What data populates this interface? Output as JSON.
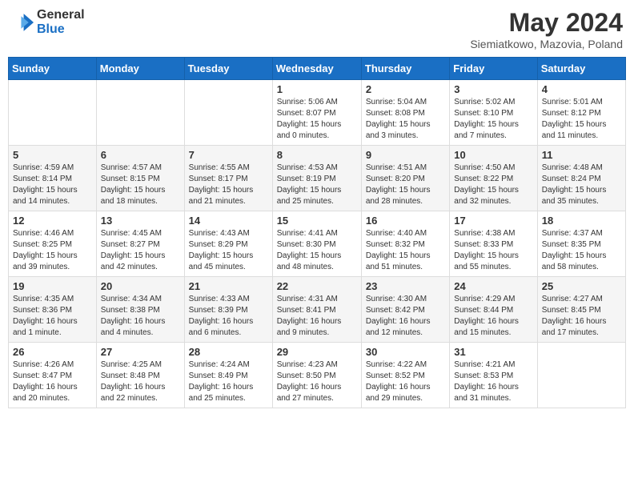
{
  "header": {
    "logo_general": "General",
    "logo_blue": "Blue",
    "month_title": "May 2024",
    "location": "Siemiatkowo, Mazovia, Poland"
  },
  "weekdays": [
    "Sunday",
    "Monday",
    "Tuesday",
    "Wednesday",
    "Thursday",
    "Friday",
    "Saturday"
  ],
  "weeks": [
    [
      {
        "day": "",
        "info": ""
      },
      {
        "day": "",
        "info": ""
      },
      {
        "day": "",
        "info": ""
      },
      {
        "day": "1",
        "info": "Sunrise: 5:06 AM\nSunset: 8:07 PM\nDaylight: 15 hours\nand 0 minutes."
      },
      {
        "day": "2",
        "info": "Sunrise: 5:04 AM\nSunset: 8:08 PM\nDaylight: 15 hours\nand 3 minutes."
      },
      {
        "day": "3",
        "info": "Sunrise: 5:02 AM\nSunset: 8:10 PM\nDaylight: 15 hours\nand 7 minutes."
      },
      {
        "day": "4",
        "info": "Sunrise: 5:01 AM\nSunset: 8:12 PM\nDaylight: 15 hours\nand 11 minutes."
      }
    ],
    [
      {
        "day": "5",
        "info": "Sunrise: 4:59 AM\nSunset: 8:14 PM\nDaylight: 15 hours\nand 14 minutes."
      },
      {
        "day": "6",
        "info": "Sunrise: 4:57 AM\nSunset: 8:15 PM\nDaylight: 15 hours\nand 18 minutes."
      },
      {
        "day": "7",
        "info": "Sunrise: 4:55 AM\nSunset: 8:17 PM\nDaylight: 15 hours\nand 21 minutes."
      },
      {
        "day": "8",
        "info": "Sunrise: 4:53 AM\nSunset: 8:19 PM\nDaylight: 15 hours\nand 25 minutes."
      },
      {
        "day": "9",
        "info": "Sunrise: 4:51 AM\nSunset: 8:20 PM\nDaylight: 15 hours\nand 28 minutes."
      },
      {
        "day": "10",
        "info": "Sunrise: 4:50 AM\nSunset: 8:22 PM\nDaylight: 15 hours\nand 32 minutes."
      },
      {
        "day": "11",
        "info": "Sunrise: 4:48 AM\nSunset: 8:24 PM\nDaylight: 15 hours\nand 35 minutes."
      }
    ],
    [
      {
        "day": "12",
        "info": "Sunrise: 4:46 AM\nSunset: 8:25 PM\nDaylight: 15 hours\nand 39 minutes."
      },
      {
        "day": "13",
        "info": "Sunrise: 4:45 AM\nSunset: 8:27 PM\nDaylight: 15 hours\nand 42 minutes."
      },
      {
        "day": "14",
        "info": "Sunrise: 4:43 AM\nSunset: 8:29 PM\nDaylight: 15 hours\nand 45 minutes."
      },
      {
        "day": "15",
        "info": "Sunrise: 4:41 AM\nSunset: 8:30 PM\nDaylight: 15 hours\nand 48 minutes."
      },
      {
        "day": "16",
        "info": "Sunrise: 4:40 AM\nSunset: 8:32 PM\nDaylight: 15 hours\nand 51 minutes."
      },
      {
        "day": "17",
        "info": "Sunrise: 4:38 AM\nSunset: 8:33 PM\nDaylight: 15 hours\nand 55 minutes."
      },
      {
        "day": "18",
        "info": "Sunrise: 4:37 AM\nSunset: 8:35 PM\nDaylight: 15 hours\nand 58 minutes."
      }
    ],
    [
      {
        "day": "19",
        "info": "Sunrise: 4:35 AM\nSunset: 8:36 PM\nDaylight: 16 hours\nand 1 minute."
      },
      {
        "day": "20",
        "info": "Sunrise: 4:34 AM\nSunset: 8:38 PM\nDaylight: 16 hours\nand 4 minutes."
      },
      {
        "day": "21",
        "info": "Sunrise: 4:33 AM\nSunset: 8:39 PM\nDaylight: 16 hours\nand 6 minutes."
      },
      {
        "day": "22",
        "info": "Sunrise: 4:31 AM\nSunset: 8:41 PM\nDaylight: 16 hours\nand 9 minutes."
      },
      {
        "day": "23",
        "info": "Sunrise: 4:30 AM\nSunset: 8:42 PM\nDaylight: 16 hours\nand 12 minutes."
      },
      {
        "day": "24",
        "info": "Sunrise: 4:29 AM\nSunset: 8:44 PM\nDaylight: 16 hours\nand 15 minutes."
      },
      {
        "day": "25",
        "info": "Sunrise: 4:27 AM\nSunset: 8:45 PM\nDaylight: 16 hours\nand 17 minutes."
      }
    ],
    [
      {
        "day": "26",
        "info": "Sunrise: 4:26 AM\nSunset: 8:47 PM\nDaylight: 16 hours\nand 20 minutes."
      },
      {
        "day": "27",
        "info": "Sunrise: 4:25 AM\nSunset: 8:48 PM\nDaylight: 16 hours\nand 22 minutes."
      },
      {
        "day": "28",
        "info": "Sunrise: 4:24 AM\nSunset: 8:49 PM\nDaylight: 16 hours\nand 25 minutes."
      },
      {
        "day": "29",
        "info": "Sunrise: 4:23 AM\nSunset: 8:50 PM\nDaylight: 16 hours\nand 27 minutes."
      },
      {
        "day": "30",
        "info": "Sunrise: 4:22 AM\nSunset: 8:52 PM\nDaylight: 16 hours\nand 29 minutes."
      },
      {
        "day": "31",
        "info": "Sunrise: 4:21 AM\nSunset: 8:53 PM\nDaylight: 16 hours\nand 31 minutes."
      },
      {
        "day": "",
        "info": ""
      }
    ]
  ]
}
